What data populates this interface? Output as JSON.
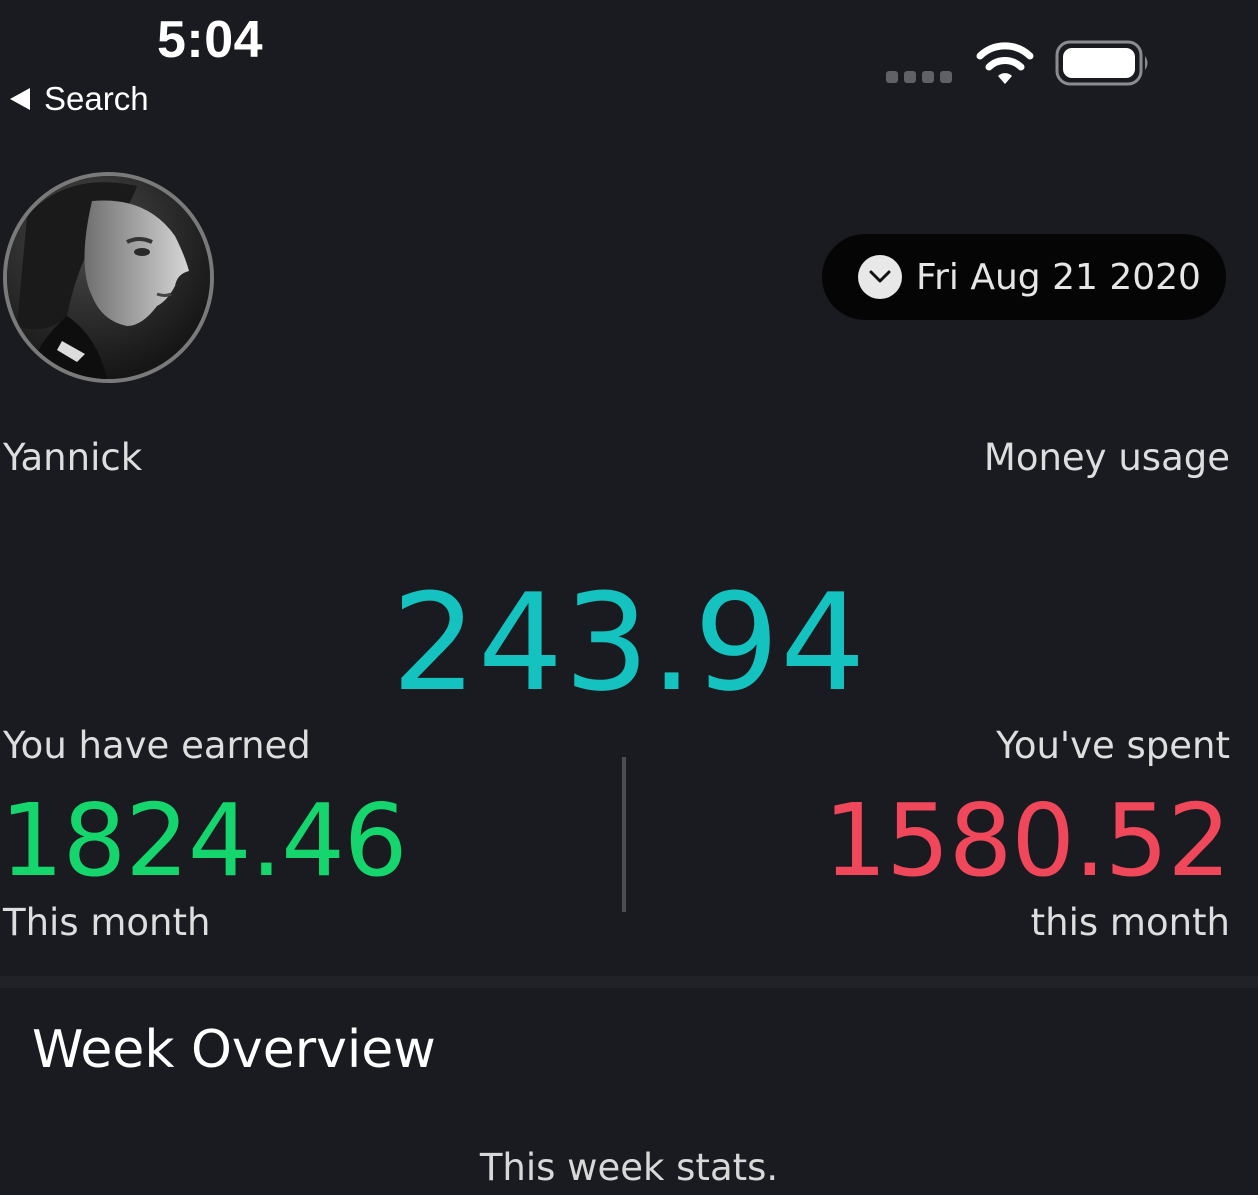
{
  "status_bar": {
    "time": "5:04",
    "back_label": "Search"
  },
  "profile": {
    "name": "Yannick"
  },
  "date_picker": {
    "value": "Fri Aug 21 2020"
  },
  "summary": {
    "section_label": "Money usage",
    "balance": "243.94",
    "earned_label": "You have earned",
    "earned_value": "1824.46",
    "earned_period": "This month",
    "spent_label": "You've spent",
    "spent_value": "1580.52",
    "spent_period": "this month"
  },
  "week": {
    "title": "Week Overview",
    "subtitle": "This week stats."
  },
  "colors": {
    "background": "#191b20",
    "balance": "#14c3bf",
    "earned": "#15d66c",
    "spent": "#f0475a",
    "pill": "#050505"
  }
}
